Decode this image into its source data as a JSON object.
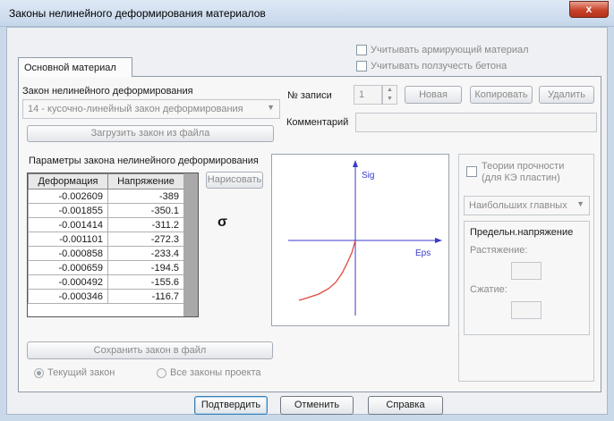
{
  "window": {
    "title": "Законы нелинейного деформирования материалов",
    "close_label": "x"
  },
  "options": {
    "reinforcing": "Учитывать армирующий материал",
    "creep": "Учитывать ползучесть бетона"
  },
  "tab": {
    "label": "Основной материал"
  },
  "law": {
    "label": "Закон нелинейного деформирования",
    "selected": "14 - кусочно-линейный закон деформирования",
    "load_button": "Загрузить закон из файла"
  },
  "record": {
    "label": "№ записи",
    "value": "1",
    "new": "Новая",
    "copy": "Копировать",
    "delete": "Удалить",
    "comment_label": "Комментарий",
    "comment_value": ""
  },
  "params": {
    "label": "Параметры закона нелинейного деформирования",
    "columns": [
      "Деформация",
      "Напряжение"
    ],
    "rows": [
      [
        "-0.002609",
        "-389"
      ],
      [
        "-0.001855",
        "-350.1"
      ],
      [
        "-0.001414",
        "-311.2"
      ],
      [
        "-0.001101",
        "-272.3"
      ],
      [
        "-0.000858",
        "-233.4"
      ],
      [
        "-0.000659",
        "-194.5"
      ],
      [
        "-0.000492",
        "-155.6"
      ],
      [
        "-0.000346",
        "-116.7"
      ]
    ],
    "draw_button": "Нарисовать",
    "sigma": "σ"
  },
  "graph": {
    "y_label": "Sig",
    "x_label": "Eps",
    "axis_color": "#3a3acc",
    "curve_color": "#e0473c"
  },
  "strength": {
    "label_line1": "Теории прочности",
    "label_line2": "(для КЭ пластин)",
    "theory": "Наибольших главных",
    "limit_title": "Предельн.напряжение",
    "tension_label": "Растяжение:",
    "tension_value": "",
    "compression_label": "Сжатие:",
    "compression_value": ""
  },
  "save_button": "Сохранить закон в файл",
  "scope": {
    "current": "Текущий закон",
    "all": "Все законы проекта"
  },
  "footer": {
    "confirm": "Подтвердить",
    "cancel": "Отменить",
    "help": "Справка"
  }
}
